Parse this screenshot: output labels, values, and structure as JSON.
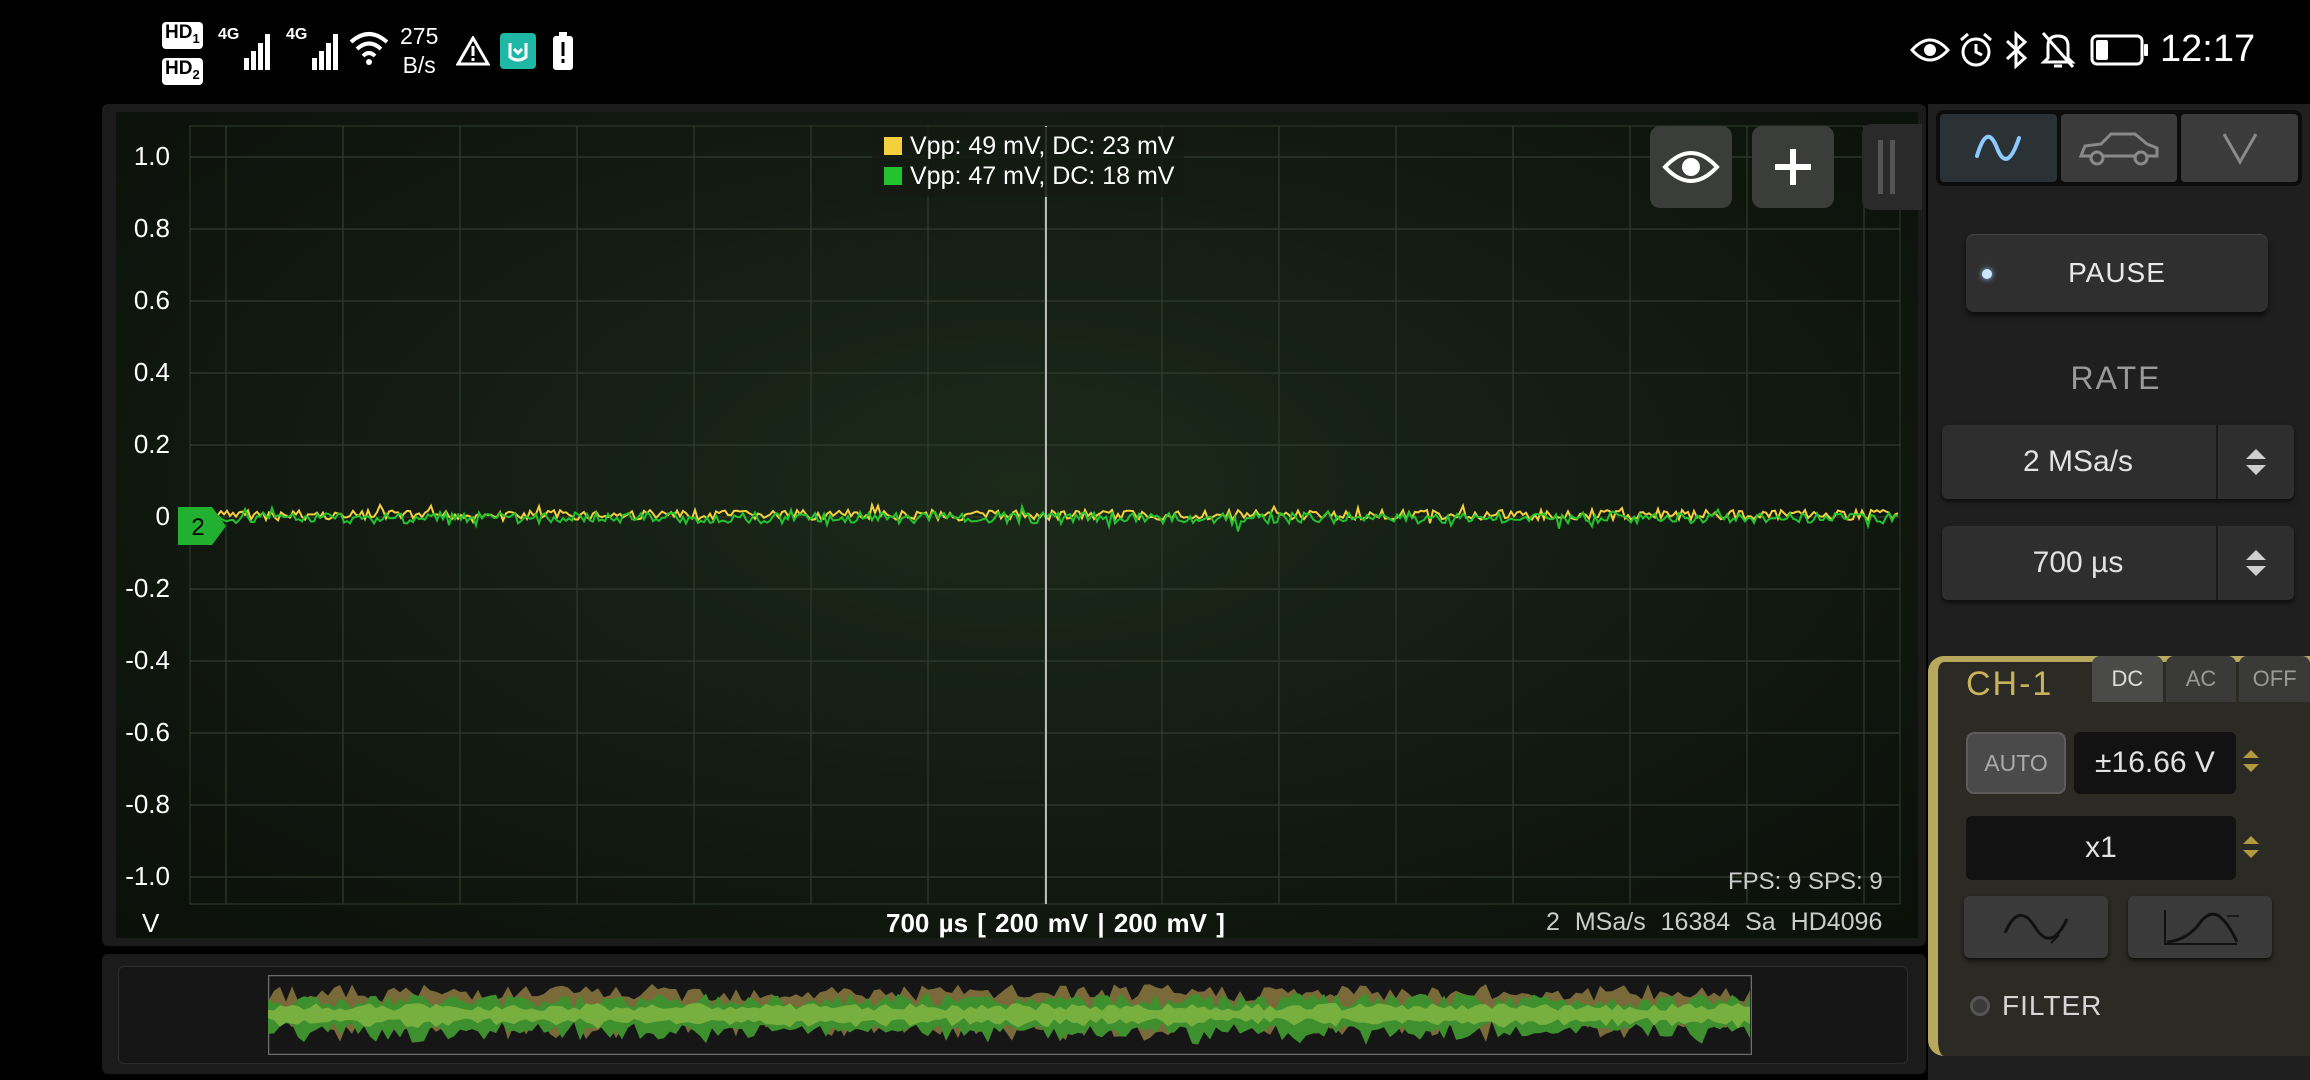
{
  "status_bar": {
    "sim1_label": "HD",
    "sim1_index": "1",
    "sim2_label": "HD",
    "sim2_index": "2",
    "network_type_1": "4G",
    "network_type_2": "4G",
    "net_speed_value": "275",
    "net_speed_unit": "B/s",
    "time": "12:17",
    "icons": [
      "hd-icon",
      "signal-icon",
      "wifi-icon",
      "warning-icon",
      "mi-app-icon",
      "battery-alert-icon",
      "eye-icon",
      "alarm-icon",
      "bluetooth-icon",
      "mute-icon",
      "battery-icon"
    ]
  },
  "scope": {
    "y_axis_ticks": [
      "1.0",
      "0.8",
      "0.6",
      "0.4",
      "0.2",
      "0",
      "-0.2",
      "-0.4",
      "-0.6",
      "-0.8",
      "-1.0"
    ],
    "y_axis_unit": "V",
    "legend": [
      {
        "text": "Vpp: 49 mV, DC: 23 mV",
        "color": "#f4d03f"
      },
      {
        "text": "Vpp: 47 mV, DC: 18 mV",
        "color": "#22c32e"
      }
    ],
    "channel_marker": "2",
    "channel_marker_color": "#22b030",
    "timebase_label": "700 µs  [ 200 mV | 200 mV ]",
    "fps_label": "FPS: 9  SPS: 9",
    "acquisition_label": "2 MSa/s  16384 Sa  HD4096",
    "signal_level_v": 0.0
  },
  "controls": {
    "mode_tabs": [
      {
        "name": "scope-mode-tab",
        "icon": "sine-wave-icon",
        "active": true
      },
      {
        "name": "automotive-mode-tab",
        "icon": "car-icon",
        "active": false
      },
      {
        "name": "voltmeter-mode-tab",
        "icon": "v-letter-icon",
        "active": false
      }
    ],
    "pause_label": "PAUSE",
    "rate_title": "RATE",
    "sample_rate": "2 MSa/s",
    "timebase": "700 µs"
  },
  "channel": {
    "title": "CH-1",
    "coupling": [
      "DC",
      "AC",
      "OFF"
    ],
    "coupling_selected": "DC",
    "auto_label": "AUTO",
    "range": "±16.66 V",
    "probe": "x1",
    "filter_label": "FILTER",
    "accent_color": "#c9b25a"
  }
}
